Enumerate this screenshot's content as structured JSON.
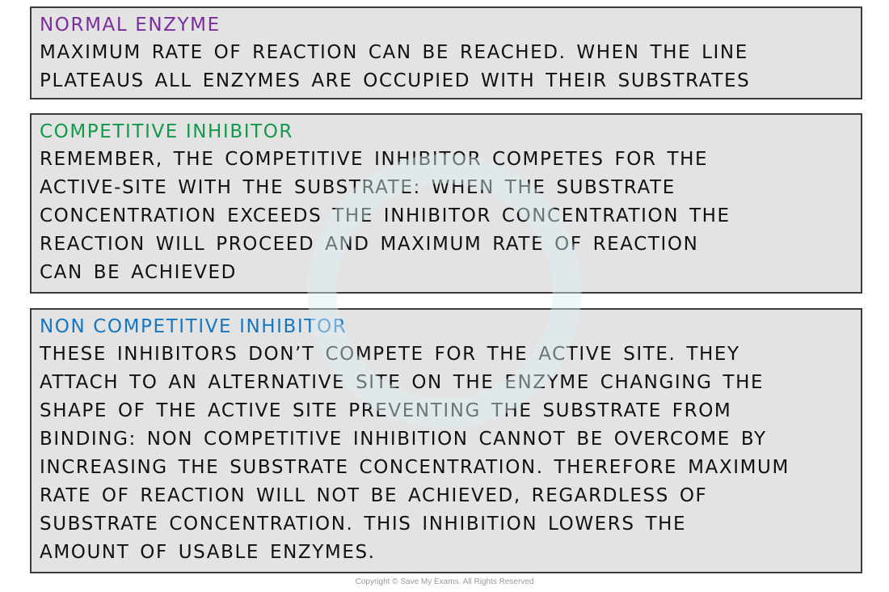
{
  "sections": [
    {
      "title": "NORMAL  ENZYME",
      "title_color": "#7b2d9e",
      "lines": [
        "MAXIMUM  RATE  OF  REACTION  CAN  BE  REACHED.  WHEN  THE  LINE",
        "PLATEAUS  ALL  ENZYMES  ARE  OCCUPIED  WITH  THEIR  SUBSTRATES"
      ]
    },
    {
      "title": "COMPETITIVE  INHIBITOR",
      "title_color": "#12994a",
      "lines": [
        "REMEMBER,  THE  COMPETITIVE  INHIBITOR  COMPETES  FOR  THE",
        "ACTIVE-SITE  WITH  THE   SUBSTRATE:  WHEN  THE  SUBSTRATE",
        "CONCENTRATION  EXCEEDS  THE  INHIBITOR  CONCENTRATION  THE",
        "REACTION  WILL  PROCEED  AND  MAXIMUM  RATE  OF  REACTION",
        "CAN  BE  ACHIEVED"
      ]
    },
    {
      "title": "NON  COMPETITIVE  INHIBITOR",
      "title_color": "#1577c4",
      "lines": [
        "THESE  INHIBITORS  DON’T  COMPETE  FOR  THE  ACTIVE  SITE.  THEY",
        "ATTACH  TO  AN  ALTERNATIVE  SITE  ON  THE  ENZYME  CHANGING  THE",
        "SHAPE  OF  THE  ACTIVE  SITE  PREVENTING  THE  SUBSTRATE  FROM",
        "BINDING:  NON  COMPETITIVE  INHIBITION  CANNOT  BE  OVERCOME  BY",
        "INCREASING  THE  SUBSTRATE  CONCENTRATION.  THEREFORE  MAXIMUM",
        "RATE  OF  REACTION  WILL  NOT  BE  ACHIEVED,  REGARDLESS  OF",
        "SUBSTRATE   CONCENTRATION.  THIS  INHIBITION  LOWERS  THE",
        "AMOUNT  OF  USABLE  ENZYMES."
      ]
    }
  ],
  "footer": {
    "copyright": "Copyright © Save My Exams. All Rights Reserved"
  }
}
